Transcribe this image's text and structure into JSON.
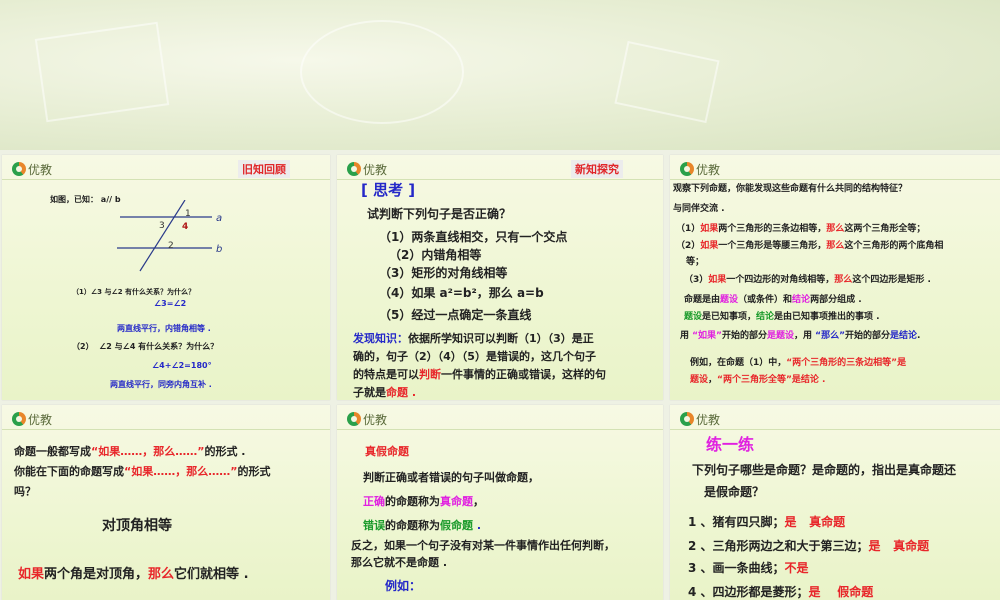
{
  "colors": {
    "k": "#222222",
    "r": "#e8262a",
    "m": "#e020e0",
    "g": "#1a9a2a",
    "b": "#2428c8",
    "d": "#b01818"
  },
  "logo_text": "优教",
  "slides": [
    {
      "tag": "旧知回顾",
      "lines": [
        [
          [
            "如图，已知： ",
            "k"
          ],
          [
            "a// b",
            "k"
          ]
        ],
        [
          [
            "（1）∠3 与∠2 有什么关系？为什么？",
            "k"
          ]
        ],
        [
          [
            "∠3=∠2",
            "b"
          ]
        ],
        [
          [
            "两直线平行，内错角相等 .",
            "b"
          ]
        ],
        [
          [
            "（2）  ∠2 与∠4 有什么关系？为什么？",
            "k"
          ]
        ],
        [
          [
            "∠4+∠2=180°",
            "b"
          ]
        ],
        [
          [
            "两直线平行，同旁内角互补 .",
            "b"
          ]
        ]
      ],
      "figure": {
        "line_a": "a",
        "line_b": "b",
        "angles": [
          "1",
          "2",
          "3",
          "4"
        ]
      }
    },
    {
      "tag": "新知探究",
      "lines": [
        [
          [
            "[ 思考 ]",
            "b"
          ]
        ],
        [
          [
            "试判断下列句子是否正确？",
            "k"
          ]
        ],
        [
          [
            "（1）两条直线相交，只有一个交点",
            "k"
          ]
        ],
        [
          [
            "（2）内错角相等",
            "k"
          ]
        ],
        [
          [
            "（3）矩形的对角线相等",
            "k"
          ]
        ],
        [
          [
            "（4）如果 a²=b²，那么 a=b",
            "k"
          ]
        ],
        [
          [
            "（5）经过一点确定一条直线",
            "k"
          ]
        ],
        [
          [
            "发现知识：",
            "b"
          ],
          [
            "依据所学知识可以判断（1）（3）是正",
            "k"
          ]
        ],
        [
          [
            "确的，句子（2）（4）（5）是错误的，这几个句子",
            "k"
          ]
        ],
        [
          [
            "的特点是可以",
            "k"
          ],
          [
            "判断",
            "r"
          ],
          [
            "一件事情的正确或错误，这样的句",
            "k"
          ]
        ],
        [
          [
            "子就是",
            "k"
          ],
          [
            "命题 .",
            "r"
          ]
        ]
      ]
    },
    {
      "lines": [
        [
          [
            "观察下列命题，你能发现这些命题有什么共同的结构特征？",
            "k"
          ]
        ],
        [
          [
            "与同伴交流 .",
            "k"
          ]
        ],
        [
          [
            "（1）",
            "k"
          ],
          [
            "如果",
            "r"
          ],
          [
            "两个三角形的三条边相等，",
            "k"
          ],
          [
            "那么",
            "r"
          ],
          [
            "这两个三角形全等；",
            "k"
          ]
        ],
        [
          [
            "（2）",
            "k"
          ],
          [
            "如果",
            "r"
          ],
          [
            "一个三角形是等腰三角形，",
            "k"
          ],
          [
            "那么",
            "r"
          ],
          [
            "这个三角形的两个底角相",
            "k"
          ]
        ],
        [
          [
            "等；",
            "k"
          ]
        ],
        [
          [
            "（3）",
            "k"
          ],
          [
            "如果",
            "r"
          ],
          [
            "一个四边形的对角线相等，",
            "k"
          ],
          [
            "那么",
            "r"
          ],
          [
            "这个四边形是矩形 .",
            "k"
          ]
        ],
        [
          [
            "命题是由",
            "k"
          ],
          [
            "题设",
            "m"
          ],
          [
            "（或条件）和",
            "k"
          ],
          [
            "结论",
            "m"
          ],
          [
            "两部分组成 .",
            "k"
          ]
        ],
        [
          [
            "题设",
            "g"
          ],
          [
            "是已知事项，",
            "k"
          ],
          [
            "结论",
            "g"
          ],
          [
            "是由已知事项推出的事项 .",
            "k"
          ]
        ],
        [
          [
            "用 ",
            "k"
          ],
          [
            "“如果”",
            "m"
          ],
          [
            "开始的部分",
            "k"
          ],
          [
            "是题设",
            "m"
          ],
          [
            "，用 ",
            "k"
          ],
          [
            "“那么”",
            "b"
          ],
          [
            "开始的部分",
            "k"
          ],
          [
            "是结论",
            "b"
          ],
          [
            ".",
            "k"
          ]
        ],
        [
          [
            "例如，在命题（1）中，",
            "k"
          ],
          [
            "“两个三角形的三条边相等”是",
            "r"
          ]
        ],
        [
          [
            "题设",
            "r"
          ],
          [
            "，",
            "k"
          ],
          [
            "“两个三角形全等”是结论 .",
            "r"
          ]
        ]
      ]
    },
    {
      "lines": [
        [
          [
            "命题一般都写成",
            "k"
          ],
          [
            "“如果……，那么……”",
            "r"
          ],
          [
            "的形式 .",
            "k"
          ]
        ],
        [
          [
            "你能在下面的命题写成",
            "k"
          ],
          [
            "“如果……，那么……”",
            "r"
          ],
          [
            "的形式",
            "k"
          ]
        ],
        [
          [
            "吗？",
            "k"
          ]
        ],
        [
          [
            "对顶角相等",
            "k"
          ]
        ],
        [
          [
            "如果",
            "r"
          ],
          [
            "两个角是对顶角，",
            "k"
          ],
          [
            "那么",
            "r"
          ],
          [
            "它们就相等 .",
            "k"
          ]
        ]
      ]
    },
    {
      "lines": [
        [
          [
            "真假命题",
            "r"
          ]
        ],
        [
          [
            "判断正确或者错误的句子叫做命题，",
            "k"
          ]
        ],
        [
          [
            "正确",
            "m"
          ],
          [
            "的命题称为",
            "k"
          ],
          [
            "真命题",
            "m"
          ],
          [
            "，",
            "k"
          ]
        ],
        [
          [
            "错误",
            "g"
          ],
          [
            "的命题称为",
            "k"
          ],
          [
            "假命题",
            "g"
          ],
          [
            " .",
            "b"
          ]
        ],
        [
          [
            "反之，如果一个句子没有对某一件事情作出任何判断，",
            "k"
          ]
        ],
        [
          [
            "那么它就不是命题 .",
            "k"
          ]
        ],
        [
          [
            "例如：",
            "b"
          ]
        ]
      ]
    },
    {
      "lines": [
        [
          [
            "练一练",
            "m"
          ]
        ],
        [
          [
            "下列句子哪些是命题？是命题的，指出是真命题还",
            "k"
          ]
        ],
        [
          [
            "是假命题？",
            "k"
          ]
        ],
        [
          [
            "1 、猪有四只脚；",
            "k"
          ],
          [
            "是   真命题",
            "r"
          ]
        ],
        [
          [
            "2 、三角形两边之和大于第三边；",
            "k"
          ],
          [
            "是   真命题",
            "r"
          ]
        ],
        [
          [
            "3 、画一条曲线；",
            "k"
          ],
          [
            "不是",
            "r"
          ]
        ],
        [
          [
            "4 、四边形都是菱形；",
            "k"
          ],
          [
            "是    假命题",
            "r"
          ]
        ]
      ]
    }
  ]
}
